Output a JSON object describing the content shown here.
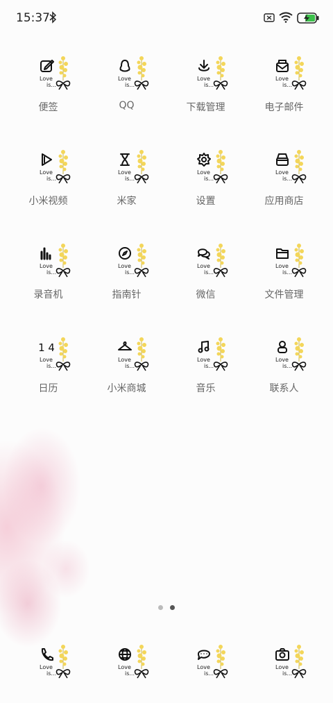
{
  "status_bar": {
    "time": "15:37"
  },
  "love_line1": "Love",
  "love_line2": "is...",
  "apps": [
    {
      "label": "便签",
      "icon": "notes-icon"
    },
    {
      "label": "QQ",
      "icon": "qq-icon"
    },
    {
      "label": "下载管理",
      "icon": "download-icon"
    },
    {
      "label": "电子邮件",
      "icon": "email-icon"
    },
    {
      "label": "小米视频",
      "icon": "video-icon"
    },
    {
      "label": "米家",
      "icon": "hourglass-icon"
    },
    {
      "label": "设置",
      "icon": "gear-icon"
    },
    {
      "label": "应用商店",
      "icon": "store-icon"
    },
    {
      "label": "录音机",
      "icon": "recorder-icon"
    },
    {
      "label": "指南针",
      "icon": "compass-icon"
    },
    {
      "label": "微信",
      "icon": "wechat-icon"
    },
    {
      "label": "文件管理",
      "icon": "folder-icon"
    },
    {
      "label": "日历",
      "icon": "calendar-icon",
      "glyph_text": "14"
    },
    {
      "label": "小米商城",
      "icon": "hanger-icon"
    },
    {
      "label": "音乐",
      "icon": "music-icon"
    },
    {
      "label": "联系人",
      "icon": "contact-icon"
    }
  ],
  "dock": [
    {
      "icon": "phone-icon"
    },
    {
      "icon": "browser-icon"
    },
    {
      "icon": "message-icon"
    },
    {
      "icon": "camera-icon"
    }
  ],
  "pages": {
    "count": 2,
    "current": 2
  },
  "colors": {
    "flower": "#f3d65a",
    "label": "#666666",
    "dot_active": "#555555",
    "dot_inactive": "#bbbbbb"
  }
}
